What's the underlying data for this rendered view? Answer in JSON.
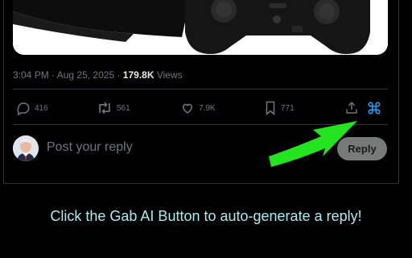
{
  "post": {
    "meta": {
      "time": "3:04 PM",
      "separator": " · ",
      "date": "Aug 25, 2025",
      "views_count": "179.8K",
      "views_label": " Views"
    },
    "actions": {
      "replies": "416",
      "reposts": "561",
      "likes": "7.9K",
      "bookmarks": "771"
    }
  },
  "reply": {
    "placeholder": "Post your reply",
    "button_label": "Reply"
  },
  "annotation": {
    "caption": "Click the Gab AI Button to auto-generate a reply!",
    "arrow_color": "#22e51f",
    "caption_color": "#a8ecf3"
  },
  "colors": {
    "gab_icon": "#1d9bf0",
    "muted": "#71767b"
  },
  "icons": {
    "reply": "reply-icon",
    "repost": "repost-icon",
    "like": "heart-icon",
    "bookmark": "bookmark-icon",
    "share": "share-icon",
    "gab_ai": "command-key-icon"
  }
}
